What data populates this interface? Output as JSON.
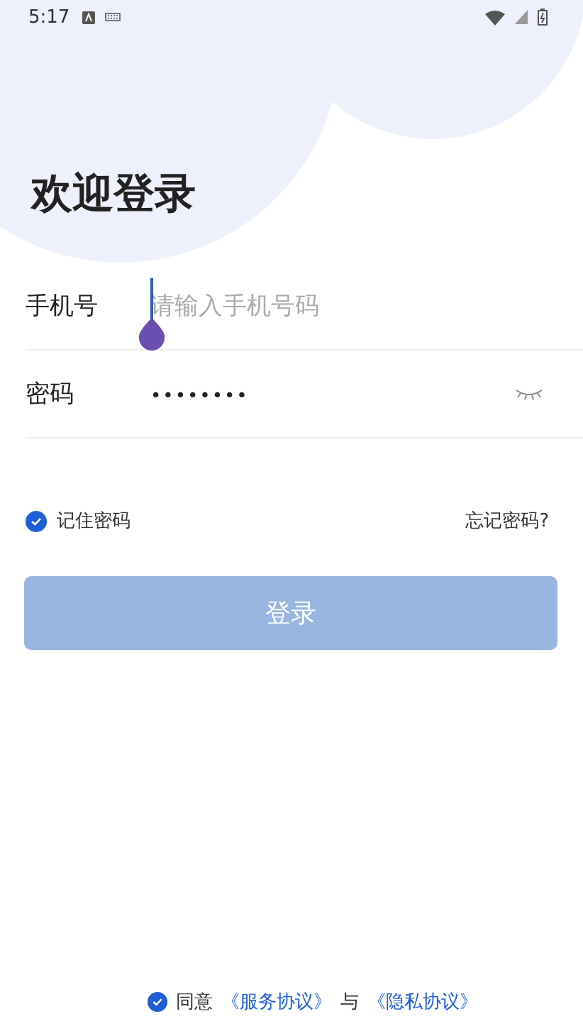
{
  "status_bar": {
    "time": "5:17"
  },
  "title": "欢迎登录",
  "form": {
    "phone": {
      "label": "手机号",
      "placeholder": "请输入手机号码",
      "focused": true
    },
    "password": {
      "label": "密码",
      "value": "••••••••",
      "visible": false
    }
  },
  "remember": {
    "label": "记住密码",
    "checked": true
  },
  "forgot": "忘记密码?",
  "login_button": {
    "label": "登录",
    "disabled": true
  },
  "agreement": {
    "checked": true,
    "parts": [
      {
        "kind": "text",
        "text": "同意"
      },
      {
        "kind": "link",
        "text": "《服务协议》"
      },
      {
        "kind": "text",
        "text": "与"
      },
      {
        "kind": "link",
        "text": "《隐私协议》"
      }
    ]
  }
}
